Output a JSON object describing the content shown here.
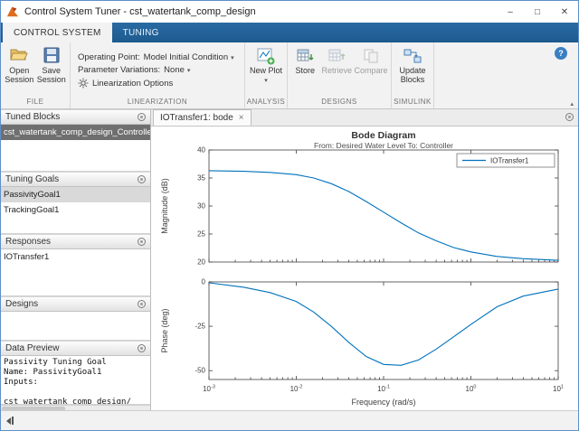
{
  "window": {
    "title": "Control System Tuner - cst_watertank_comp_design"
  },
  "icons": {
    "dropdown": "▾",
    "help": "?",
    "collapse_toolstrip": "▴",
    "window_min": "–",
    "window_max": "□",
    "window_close": "✕",
    "tab_close": "×"
  },
  "tabs": {
    "control_system": "CONTROL SYSTEM",
    "tuning": "TUNING"
  },
  "toolstrip": {
    "file": {
      "label": "FILE",
      "open_session": "Open Session",
      "save_session": "Save Session"
    },
    "linearization": {
      "label": "LINEARIZATION",
      "operating_point_label": "Operating Point:",
      "operating_point_value": "Model Initial Condition",
      "parameter_variations_label": "Parameter Variations:",
      "parameter_variations_value": "None",
      "options": "Linearization Options"
    },
    "analysis": {
      "label": "ANALYSIS",
      "new_plot": "New Plot"
    },
    "designs": {
      "label": "DESIGNS",
      "store": "Store",
      "retrieve": "Retrieve",
      "compare": "Compare"
    },
    "simulink": {
      "label": "SIMULINK",
      "update_blocks": "Update Blocks"
    }
  },
  "sidebar": {
    "tuned_blocks": {
      "title": "Tuned Blocks",
      "items": [
        {
          "label": "cst_watertank_comp_design_Controller"
        }
      ]
    },
    "tuning_goals": {
      "title": "Tuning Goals",
      "items": [
        {
          "label": "PassivityGoal1"
        },
        {
          "label": "TrackingGoal1"
        }
      ]
    },
    "responses": {
      "title": "Responses",
      "items": [
        {
          "label": "IOTransfer1"
        }
      ]
    },
    "designs": {
      "title": "Designs",
      "items": []
    },
    "data_preview": {
      "title": "Data Preview",
      "lines": [
        "Passivity Tuning Goal",
        "Name: PassivityGoal1",
        "Inputs:",
        "",
        "cst_watertank_comp_design/"
      ]
    }
  },
  "document": {
    "tab": "IOTransfer1: bode"
  },
  "chart_data": {
    "type": "line",
    "title": "Bode Diagram",
    "subtitle": "From: Desired  Water Level  To: Controller",
    "xlabel": "Frequency  (rad/s)",
    "x_scale": "log",
    "x_log_range": [
      -3,
      1
    ],
    "x_tick_exponents": [
      -3,
      -2,
      -1,
      0,
      1
    ],
    "legend": "IOTransfer1",
    "line_color": "#0072bd",
    "grid": false,
    "subplots": [
      {
        "name": "magnitude",
        "ylabel": "Magnitude (dB)",
        "ylim": [
          20,
          40
        ],
        "yticks": [
          20,
          25,
          30,
          35,
          40
        ],
        "points": {
          "logx": [
            -3,
            -2.6,
            -2.3,
            -2.0,
            -1.8,
            -1.6,
            -1.4,
            -1.2,
            -1.0,
            -0.8,
            -0.6,
            -0.4,
            -0.2,
            0,
            0.3,
            0.6,
            1
          ],
          "y": [
            36.3,
            36.2,
            36.0,
            35.6,
            35.0,
            34.0,
            32.6,
            30.8,
            28.9,
            27.0,
            25.2,
            23.8,
            22.6,
            21.8,
            21.0,
            20.6,
            20.3
          ]
        }
      },
      {
        "name": "phase",
        "ylabel": "Phase (deg)",
        "ylim": [
          -55,
          0
        ],
        "yticks": [
          0,
          -25,
          -50
        ],
        "points": {
          "logx": [
            -3,
            -2.6,
            -2.3,
            -2.0,
            -1.8,
            -1.6,
            -1.4,
            -1.2,
            -1.0,
            -0.8,
            -0.6,
            -0.4,
            -0.2,
            0,
            0.3,
            0.6,
            1
          ],
          "y": [
            -0.5,
            -3,
            -6,
            -11,
            -17,
            -25,
            -34,
            -42,
            -46.5,
            -47,
            -44,
            -38,
            -31,
            -24,
            -14,
            -8,
            -4
          ]
        }
      }
    ]
  }
}
